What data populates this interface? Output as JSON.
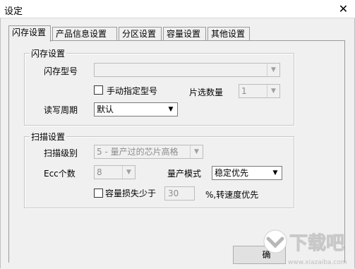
{
  "window": {
    "title": "设定",
    "close_glyph": "✕"
  },
  "tabs": [
    {
      "label": "闪存设置",
      "active": true
    },
    {
      "label": "产品信息设置",
      "active": false
    },
    {
      "label": "分区设置",
      "active": false
    },
    {
      "label": "容量设置",
      "active": false
    },
    {
      "label": "其他设置",
      "active": false
    }
  ],
  "flash_group": {
    "title": "闪存设置",
    "flash_type_label": "闪存型号",
    "flash_type_value": "",
    "manual_type_label": "手动指定型号",
    "manual_type_checked": false,
    "chip_count_label": "片选数量",
    "chip_count_value": "1",
    "rw_cycle_label": "读写周期",
    "rw_cycle_value": "默认"
  },
  "scan_group": {
    "title": "扫描设置",
    "scan_level_label": "扫描级别",
    "scan_level_value": "5 - 量产过的芯片高格",
    "ecc_label": "Ecc个数",
    "ecc_value": "8",
    "mp_mode_label": "量产模式",
    "mp_mode_value": "稳定优先",
    "capacity_loss_label": "容量损失少于",
    "capacity_loss_checked": false,
    "capacity_loss_value": "30",
    "speed_first_label": "%,转速度优先"
  },
  "buttons": {
    "ok_label": "确"
  },
  "watermark": {
    "text": "下载吧",
    "url": "www.xiazaiba.com"
  }
}
